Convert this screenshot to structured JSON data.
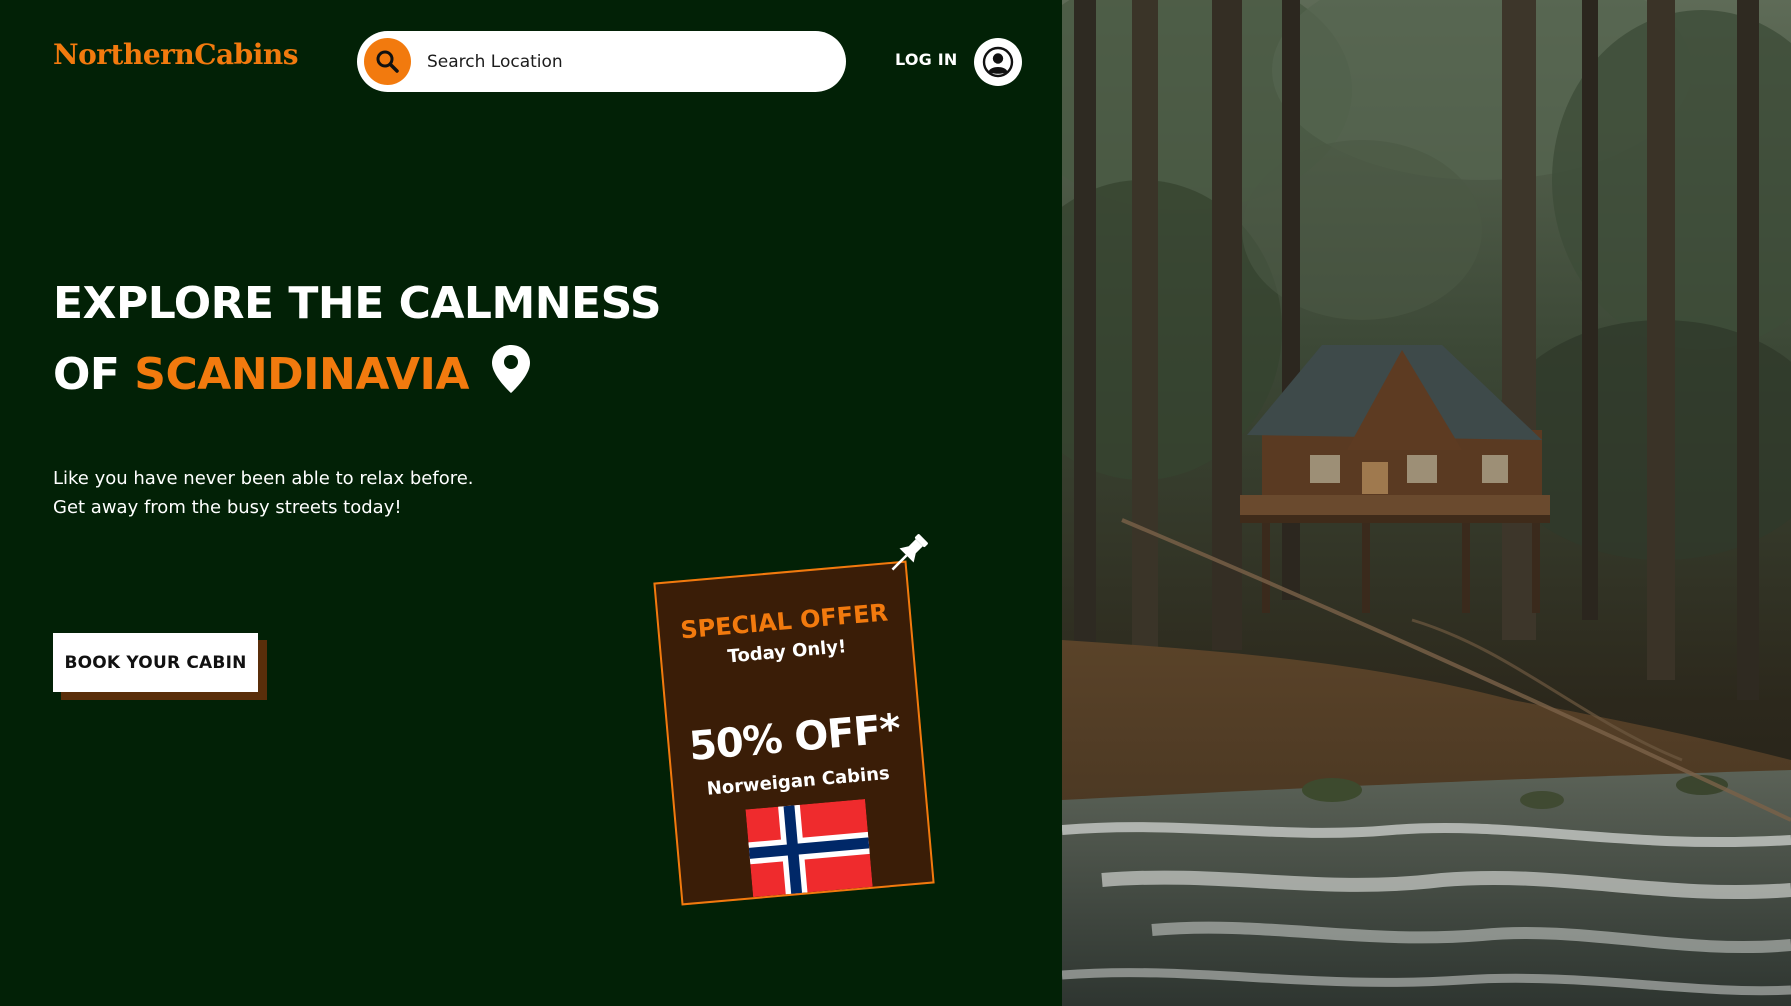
{
  "brand": {
    "name": "NorthernCabins",
    "accent_color": "#f27a0e",
    "background_color": "#022106"
  },
  "header": {
    "search_placeholder": "Search Location",
    "search_icon": "search-icon",
    "login_label": "LOG IN",
    "avatar_icon": "user-icon"
  },
  "hero": {
    "headline_line1": "EXPLORE THE CALMNESS",
    "headline_line2_prefix": "OF",
    "headline_line2_accent": "SCANDINAVIA",
    "location_icon": "location-pin-icon",
    "subtitle_line1": "Like you have never been able to relax before.",
    "subtitle_line2": "Get away from the busy streets today!",
    "cta_label": "BOOK YOUR CABIN"
  },
  "offer": {
    "title": "SPECIAL OFFER",
    "subtitle": "Today Only!",
    "discount": "50% OFF*",
    "target": "Norweigan Cabins",
    "flag_icon": "norway-flag-icon",
    "pin_icon": "pushpin-icon"
  },
  "photo": {
    "subject": "cabin-in-forest-by-river-image"
  }
}
